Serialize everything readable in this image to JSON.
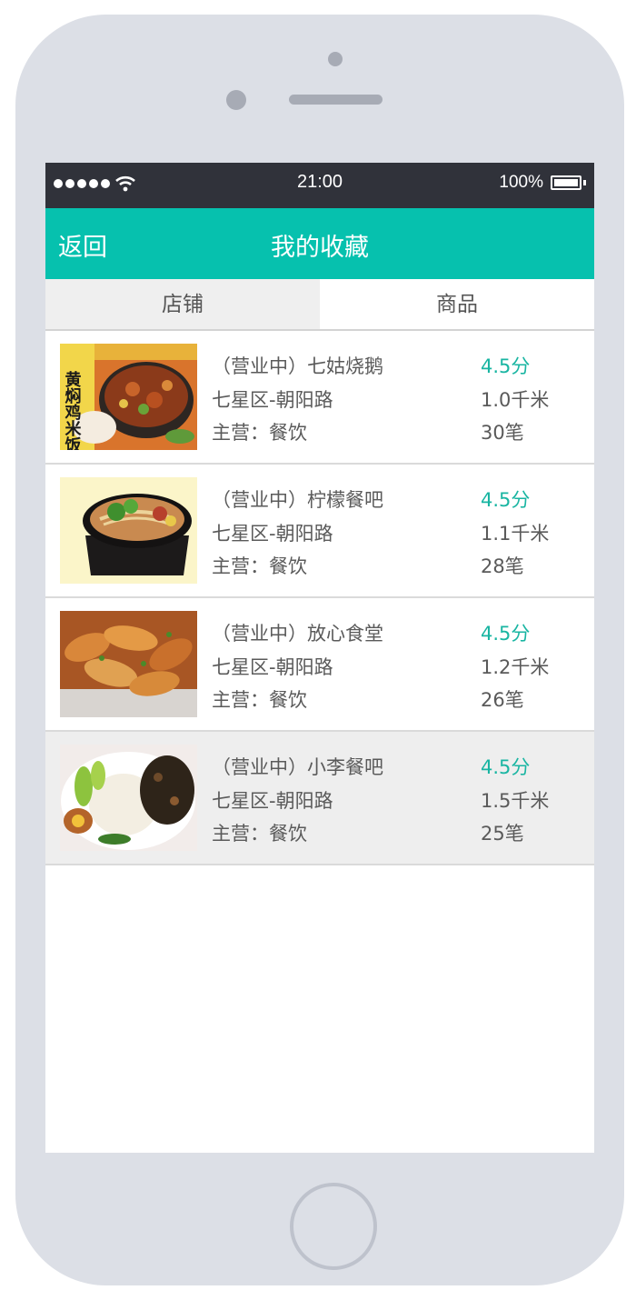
{
  "status_bar": {
    "time": "21:00",
    "battery": "100%"
  },
  "header": {
    "back_label": "返回",
    "title": "我的收藏"
  },
  "tabs": [
    {
      "label": "店铺",
      "active": true
    },
    {
      "label": "商品",
      "active": false
    }
  ],
  "stores": [
    {
      "name": "（营业中）七姑烧鹅",
      "score": "4.5分",
      "address": "七星区-朝阳路",
      "distance": "1.0千米",
      "category": "主营：餐饮",
      "orders": "30笔",
      "image_text": "黄焖鸡米饭"
    },
    {
      "name": "（营业中）柠檬餐吧",
      "score": "4.5分",
      "address": "七星区-朝阳路",
      "distance": "1.1千米",
      "category": "主营：餐饮",
      "orders": "28笔"
    },
    {
      "name": "（营业中）放心食堂",
      "score": "4.5分",
      "address": "七星区-朝阳路",
      "distance": "1.2千米",
      "category": "主营：餐饮",
      "orders": "26笔"
    },
    {
      "name": "（营业中）小李餐吧",
      "score": "4.5分",
      "address": "七星区-朝阳路",
      "distance": "1.5千米",
      "category": "主营：餐饮",
      "orders": "25笔"
    }
  ],
  "colors": {
    "accent": "#06c1ae",
    "score": "#19b5a2",
    "status_bar": "#30323a",
    "phone_frame": "#dcdfe6"
  }
}
